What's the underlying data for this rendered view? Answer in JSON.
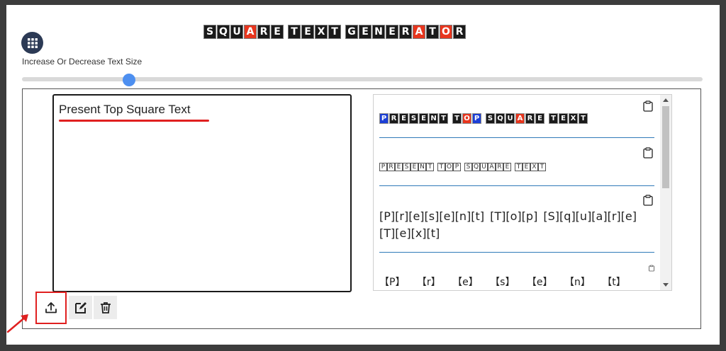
{
  "header": {
    "title_words": [
      [
        {
          "ch": "S"
        },
        {
          "ch": "Q"
        },
        {
          "ch": "U"
        },
        {
          "ch": "A",
          "red": true
        },
        {
          "ch": "R"
        },
        {
          "ch": "E"
        }
      ],
      [
        {
          "ch": "T"
        },
        {
          "ch": "E"
        },
        {
          "ch": "X"
        },
        {
          "ch": "T"
        }
      ],
      [
        {
          "ch": "G"
        },
        {
          "ch": "E"
        },
        {
          "ch": "N"
        },
        {
          "ch": "E"
        },
        {
          "ch": "R"
        },
        {
          "ch": "A",
          "red": true
        },
        {
          "ch": "T"
        },
        {
          "ch": "O",
          "red": true
        },
        {
          "ch": "R"
        }
      ]
    ],
    "size_label": "Increase Or Decrease Text Size",
    "slider_level_percent": 15
  },
  "editor": {
    "text": "Present Top Square Text"
  },
  "output": {
    "style1_words": [
      [
        {
          "ch": "P",
          "c": "blue"
        },
        {
          "ch": "R"
        },
        {
          "ch": "E"
        },
        {
          "ch": "S"
        },
        {
          "ch": "E"
        },
        {
          "ch": "N"
        },
        {
          "ch": "T"
        }
      ],
      [
        {
          "ch": "T"
        },
        {
          "ch": "O",
          "c": "red"
        },
        {
          "ch": "P",
          "c": "blue"
        }
      ],
      [
        {
          "ch": "S"
        },
        {
          "ch": "Q"
        },
        {
          "ch": "U"
        },
        {
          "ch": "A",
          "c": "red"
        },
        {
          "ch": "R"
        },
        {
          "ch": "E"
        }
      ],
      [
        {
          "ch": "T"
        },
        {
          "ch": "E"
        },
        {
          "ch": "X"
        },
        {
          "ch": "T"
        }
      ]
    ],
    "style2_words": [
      "PRESENT",
      "TOP",
      "SQUARE",
      "TEXT"
    ],
    "style3_text": "[P][r][e][s][e][n][t] [T][o][p] [S][q][u][a][r][e] [T][e][x][t]",
    "style4_text": "【P】 【r】 【e】 【s】 【e】 【n】 【t】 【T】"
  },
  "colors": {
    "accent_red": "#e02020",
    "slider_blue": "#4d8ff0",
    "separator_blue": "#2f7ab8",
    "tile_blue": "#1c3fd6"
  }
}
